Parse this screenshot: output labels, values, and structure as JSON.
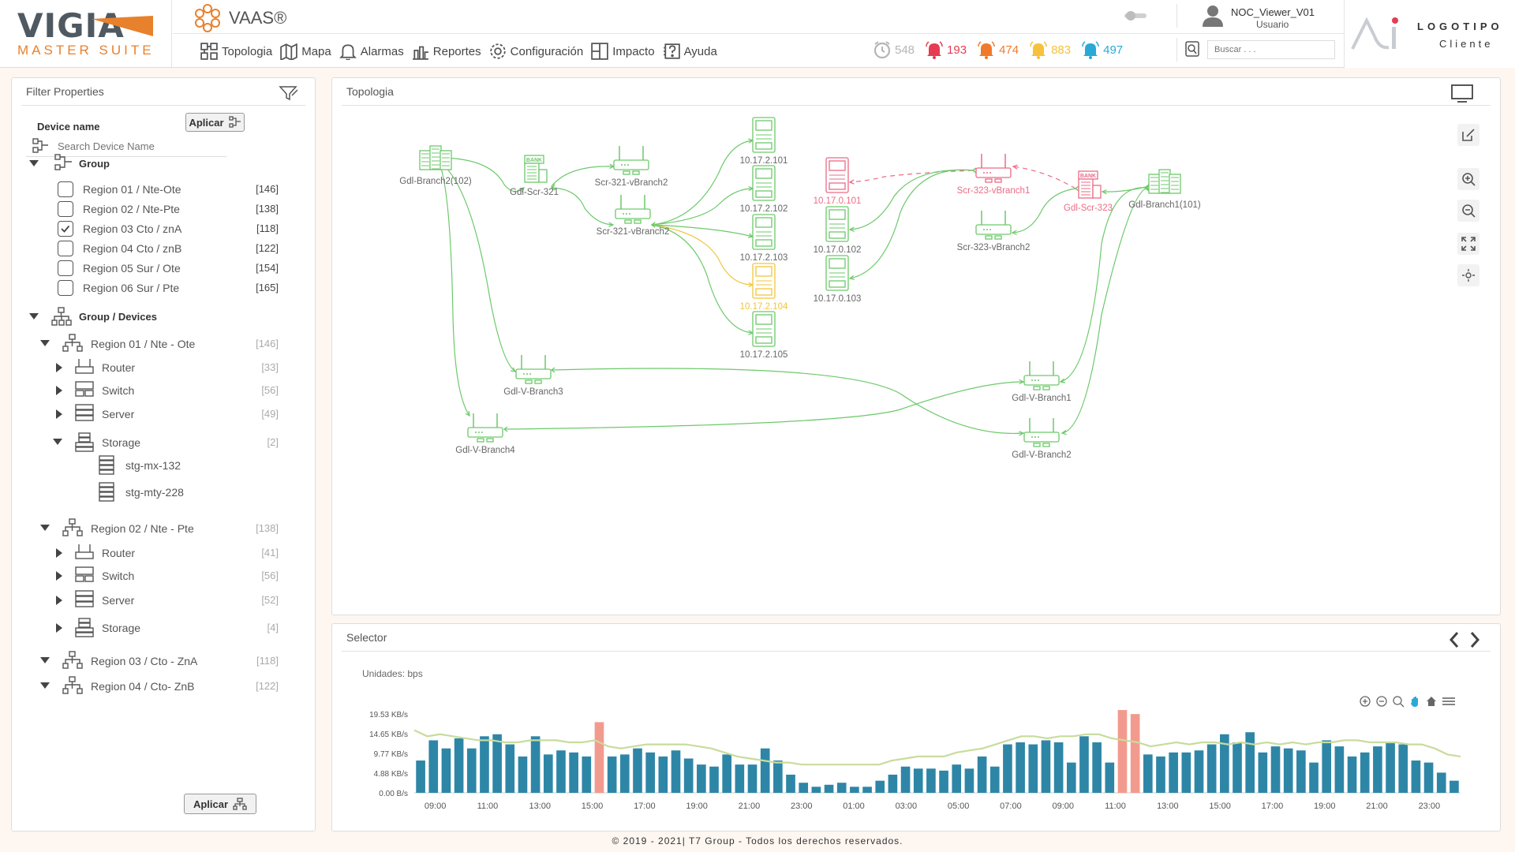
{
  "brand": {
    "title": "VIGIA",
    "subtitle": "MASTER SUITE"
  },
  "product": {
    "name": "VAAS®"
  },
  "nav": [
    {
      "label": "Topologia",
      "icon": "topology-icon"
    },
    {
      "label": "Mapa",
      "icon": "map-icon"
    },
    {
      "label": "Alarmas",
      "icon": "bell-icon"
    },
    {
      "label": "Reportes",
      "icon": "report-icon"
    },
    {
      "label": "Configuración",
      "icon": "gear-icon"
    },
    {
      "label": "Impacto",
      "icon": "impact-icon"
    },
    {
      "label": "Ayuda",
      "icon": "help-icon"
    }
  ],
  "alarms": [
    {
      "count": "548",
      "color": "#b5b5b5",
      "icon": "clock-alarm-icon"
    },
    {
      "count": "193",
      "color": "#e63b52",
      "icon": "bell-critical-icon"
    },
    {
      "count": "474",
      "color": "#f07a2c",
      "icon": "bell-major-icon"
    },
    {
      "count": "883",
      "color": "#f7c23b",
      "icon": "bell-minor-icon"
    },
    {
      "count": "497",
      "color": "#2aa9d8",
      "icon": "bell-warning-icon"
    }
  ],
  "user": {
    "name": "NOC_Viewer_V01",
    "role": "Usuario"
  },
  "search": {
    "placeholder": "Buscar . . ."
  },
  "client_logo": {
    "line1": "LOGOTIPO",
    "line2": "Cliente"
  },
  "filter": {
    "title": "Filter Properties",
    "device_name_label": "Device name",
    "device_placeholder": "Search Device Name",
    "apply_label": "Aplicar",
    "group_label": "Group",
    "groups": [
      {
        "label": "Region 01 / Nte-Ote",
        "count": "[146]",
        "checked": false
      },
      {
        "label": "Region 02 / Nte-Pte",
        "count": "[138]",
        "checked": false
      },
      {
        "label": "Region 03 Cto / znA",
        "count": "[118]",
        "checked": true
      },
      {
        "label": "Region 04 Cto / znB",
        "count": "[122]",
        "checked": false
      },
      {
        "label": "Region 05 Sur / Ote",
        "count": "[154]",
        "checked": false
      },
      {
        "label": "Region 06 Sur / Pte",
        "count": "[165]",
        "checked": false
      }
    ],
    "group_devices_label": "Group / Devices",
    "tree": {
      "r1": {
        "label": "Region 01 / Nte - Ote",
        "count": "[146]"
      },
      "r1_router": {
        "label": "Router",
        "count": "[33]"
      },
      "r1_switch": {
        "label": "Switch",
        "count": "[56]"
      },
      "r1_server": {
        "label": "Server",
        "count": "[49]"
      },
      "r1_storage": {
        "label": "Storage",
        "count": "[2]"
      },
      "r1_stg1": {
        "label": "stg-mx-132"
      },
      "r1_stg2": {
        "label": "stg-mty-228"
      },
      "r2": {
        "label": "Region 02 / Nte - Pte",
        "count": "[138]"
      },
      "r2_router": {
        "label": "Router",
        "count": "[41]"
      },
      "r2_switch": {
        "label": "Switch",
        "count": "[56]"
      },
      "r2_server": {
        "label": "Server",
        "count": "[52]"
      },
      "r2_storage": {
        "label": "Storage",
        "count": "[4]"
      },
      "r3": {
        "label": "Region 03 / Cto - ZnA",
        "count": "[118]"
      },
      "r4": {
        "label": "Region 04 / Cto- ZnB",
        "count": "[122]"
      }
    },
    "apply_bottom_label": "Aplicar"
  },
  "topology": {
    "title": "Topologia",
    "colors": {
      "ok": "#6cc96a",
      "warn": "#f2c53d",
      "crit": "#ec6b86"
    },
    "nodes": {
      "gdl_branch2_102": {
        "label": "Gdl-Branch2(102)",
        "type": "server",
        "status": "ok"
      },
      "gdl_scr_321": {
        "label": "Gdl-Scr-321",
        "type": "bank",
        "status": "ok"
      },
      "scr321_vb2a": {
        "label": "Scr-321-vBranch2",
        "type": "router",
        "status": "ok"
      },
      "scr321_vb2b": {
        "label": "Scr-321-vBranch2",
        "type": "router",
        "status": "ok"
      },
      "ip_17_2_101": {
        "label": "10.17.2.101",
        "type": "host",
        "status": "ok"
      },
      "ip_17_2_102": {
        "label": "10.17.2.102",
        "type": "host",
        "status": "ok"
      },
      "ip_17_2_103": {
        "label": "10.17.2.103",
        "type": "host",
        "status": "ok"
      },
      "ip_17_2_104": {
        "label": "10.17.2.104",
        "type": "host",
        "status": "warn"
      },
      "ip_17_2_105": {
        "label": "10.17.2.105",
        "type": "host",
        "status": "ok"
      },
      "ip_17_0_101": {
        "label": "10.17.0.101",
        "type": "host",
        "status": "crit"
      },
      "ip_17_0_102": {
        "label": "10.17.0.102",
        "type": "host",
        "status": "ok"
      },
      "ip_17_0_103": {
        "label": "10.17.0.103",
        "type": "host",
        "status": "ok"
      },
      "scr323_vb1": {
        "label": "Scr-323-vBranch1",
        "type": "router",
        "status": "crit"
      },
      "scr323_vb2": {
        "label": "Scr-323-vBranch2",
        "type": "router",
        "status": "ok"
      },
      "gdl_scr_323": {
        "label": "Gdl-Scr-323",
        "type": "bank",
        "status": "crit"
      },
      "gdl_branch1_101": {
        "label": "Gdl-Branch1(101)",
        "type": "server",
        "status": "ok"
      },
      "gdl_vbranch3": {
        "label": "Gdl-V-Branch3",
        "type": "router",
        "status": "ok"
      },
      "gdl_vbranch4": {
        "label": "Gdl-V-Branch4",
        "type": "router",
        "status": "ok"
      },
      "gdl_vbranch1": {
        "label": "Gdl-V-Branch1",
        "type": "router",
        "status": "ok"
      },
      "gdl_vbranch2": {
        "label": "Gdl-V-Branch2",
        "type": "router",
        "status": "ok"
      }
    },
    "links": [
      [
        "gdl_branch2_102",
        "gdl_scr_321",
        "ok"
      ],
      [
        "gdl_branch2_102",
        "gdl_vbranch3",
        "ok"
      ],
      [
        "gdl_branch2_102",
        "gdl_vbranch4",
        "ok"
      ],
      [
        "gdl_scr_321",
        "scr321_vb2a",
        "ok"
      ],
      [
        "gdl_scr_321",
        "scr321_vb2b",
        "ok"
      ],
      [
        "scr321_vb2b",
        "ip_17_2_101",
        "ok"
      ],
      [
        "scr321_vb2b",
        "ip_17_2_102",
        "ok"
      ],
      [
        "scr321_vb2b",
        "ip_17_2_103",
        "ok"
      ],
      [
        "scr321_vb2b",
        "ip_17_2_104",
        "warn"
      ],
      [
        "scr321_vb2b",
        "ip_17_2_105",
        "ok"
      ],
      [
        "scr323_vb1",
        "ip_17_0_101",
        "crit"
      ],
      [
        "scr323_vb1",
        "ip_17_0_102",
        "ok"
      ],
      [
        "scr323_vb1",
        "ip_17_0_103",
        "ok"
      ],
      [
        "gdl_scr_323",
        "scr323_vb1",
        "crit"
      ],
      [
        "gdl_scr_323",
        "scr323_vb2",
        "ok"
      ],
      [
        "gdl_branch1_101",
        "gdl_scr_323",
        "ok"
      ],
      [
        "gdl_branch1_101",
        "gdl_vbranch1",
        "ok"
      ],
      [
        "gdl_branch1_101",
        "gdl_vbranch2",
        "ok"
      ],
      [
        "gdl_vbranch3",
        "gdl_vbranch2",
        "ok"
      ],
      [
        "gdl_vbranch4",
        "gdl_vbranch1",
        "ok"
      ]
    ]
  },
  "selector": {
    "title": "Selector",
    "units_label": "Unidades: bps",
    "chart_data": {
      "type": "bar",
      "y_ticks": [
        "0.00 B/s",
        "4.88 KB/s",
        "9.77 KB/s",
        "14.65 KB/s",
        "19.53 KB/s"
      ],
      "y_max": 19.53,
      "x_ticks": [
        "09:00",
        "11:00",
        "13:00",
        "15:00",
        "17:00",
        "19:00",
        "21:00",
        "23:00",
        "01:00",
        "03:00",
        "05:00",
        "07:00",
        "09:00",
        "11:00",
        "13:00",
        "15:00",
        "17:00",
        "19:00",
        "21:00",
        "23:00"
      ],
      "bar_color": "#2e86a7",
      "highlight_color": "#f39a8e",
      "line_color": "#c8dc9c",
      "highlight_indices": [
        14,
        55,
        56
      ],
      "values": [
        8,
        13,
        11,
        13.5,
        11,
        14,
        14.5,
        12,
        9,
        14,
        9.5,
        10.5,
        10,
        9,
        17.5,
        9,
        9.5,
        11,
        10,
        9,
        10.5,
        8.5,
        7,
        6.5,
        9.5,
        7,
        7,
        11,
        8,
        4.5,
        2.5,
        1.5,
        2,
        2.5,
        1.5,
        1.5,
        3,
        4.5,
        6.5,
        6,
        6,
        5.5,
        7,
        6,
        9,
        6.5,
        12,
        12.5,
        12,
        13,
        12.5,
        7.5,
        14,
        12.5,
        7.5,
        20.5,
        19.5,
        9.5,
        9,
        10,
        10,
        10.5,
        12,
        14.5,
        12.5,
        15,
        10,
        11.5,
        11,
        10.5,
        7.5,
        13,
        11.5,
        9,
        10,
        11.5,
        12.5,
        12,
        8,
        7.5,
        5,
        3
      ],
      "line": [
        15.5,
        14,
        14.5,
        14,
        13.5,
        13,
        13,
        12.5,
        12.5,
        13,
        13,
        13,
        12.5,
        12.5,
        13,
        11.5,
        11,
        11.5,
        12,
        12,
        12,
        12,
        11.5,
        11,
        10,
        9,
        8.5,
        8,
        7.5,
        7.5,
        7,
        7,
        7,
        7,
        7,
        7,
        7,
        8,
        8.5,
        9,
        9,
        9,
        10,
        10.5,
        11,
        12,
        13,
        14,
        14,
        13.5,
        14,
        14,
        14.5,
        14.5,
        13.5,
        13,
        12.5,
        11.5,
        12,
        12.5,
        12,
        12.5,
        12.5,
        12,
        12.5,
        12,
        12.5,
        12,
        12.5,
        12,
        12.5,
        12.5,
        13,
        13,
        12.5,
        12.5,
        12.5,
        12,
        12,
        11,
        9.5,
        9
      ]
    }
  },
  "footer": "© 2019 - 2021| T7 Group - Todos los derechos reservados."
}
